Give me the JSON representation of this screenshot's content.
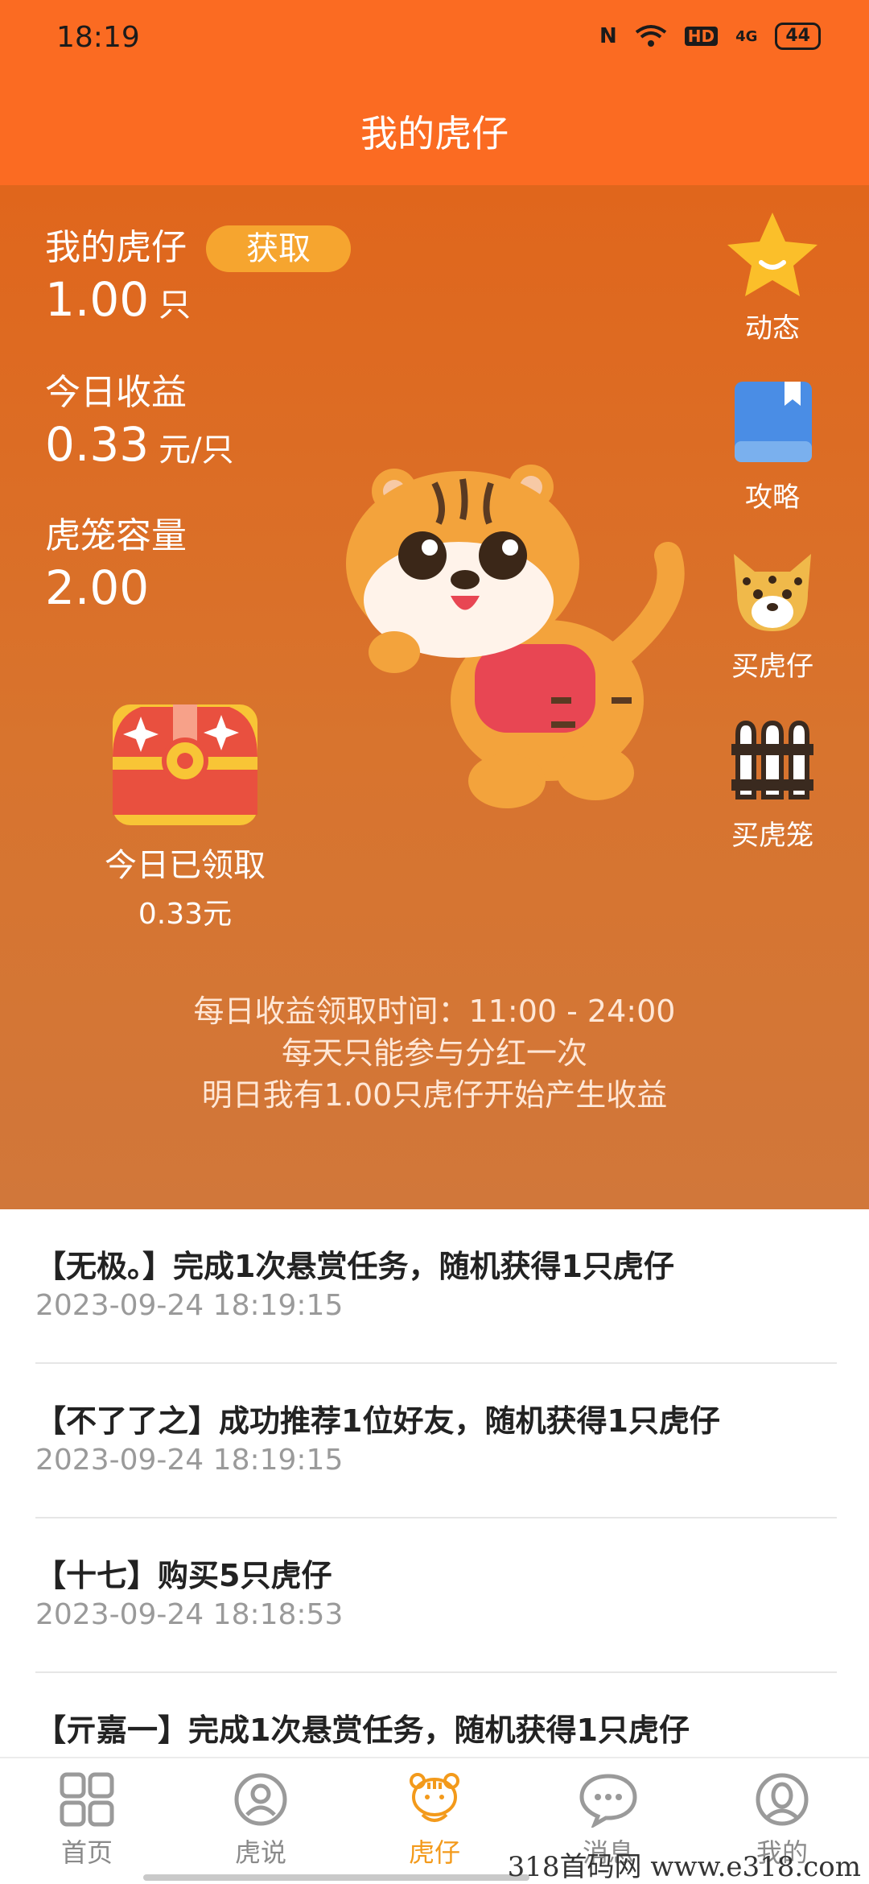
{
  "status_bar": {
    "time": "18:19",
    "nfc": "N",
    "network_label": "HD",
    "signal_label": "4G",
    "battery": "44"
  },
  "header": {
    "title": "我的虎仔"
  },
  "hero": {
    "my_tiger": {
      "label": "我的虎仔",
      "get_button": "获取",
      "value": "1.00",
      "unit": "只"
    },
    "today_income": {
      "label": "今日收益",
      "value": "0.33",
      "unit": "元/只"
    },
    "cage_capacity": {
      "label": "虎笼容量",
      "value": "2.00"
    },
    "chest": {
      "status": "今日已领取",
      "amount": "0.33元"
    },
    "side_menu": [
      {
        "label": "动态",
        "icon": "star-icon"
      },
      {
        "label": "攻略",
        "icon": "book-icon"
      },
      {
        "label": "买虎仔",
        "icon": "leopard-face-icon"
      },
      {
        "label": "买虎笼",
        "icon": "cage-icon"
      }
    ],
    "notes": [
      "每日收益领取时间：11:00 - 24:00",
      "每天只能参与分红一次",
      "明日我有1.00只虎仔开始产生收益"
    ]
  },
  "feed": [
    {
      "message": "【无极。】完成1次悬赏任务，随机获得1只虎仔",
      "time": "2023-09-24 18:19:15"
    },
    {
      "message": "【不了了之】成功推荐1位好友，随机获得1只虎仔",
      "time": "2023-09-24 18:19:15"
    },
    {
      "message": "【十七】购买5只虎仔",
      "time": "2023-09-24 18:18:53"
    },
    {
      "message": "【亓嘉一】完成1次悬赏任务，随机获得1只虎仔",
      "time": ""
    }
  ],
  "tabs": [
    {
      "label": "首页",
      "icon": "grid-icon",
      "active": false
    },
    {
      "label": "虎说",
      "icon": "person-circle-icon",
      "active": false
    },
    {
      "label": "虎仔",
      "icon": "tiger-icon",
      "active": true
    },
    {
      "label": "消息",
      "icon": "chat-bubble-icon",
      "active": false
    },
    {
      "label": "我的",
      "icon": "user-icon",
      "active": false
    }
  ],
  "watermark": "318首码网 www.e318.com",
  "colors": {
    "brand_orange": "#fb6b22",
    "active_tab": "#f39a1b",
    "button_yellow": "#f6a52f"
  }
}
